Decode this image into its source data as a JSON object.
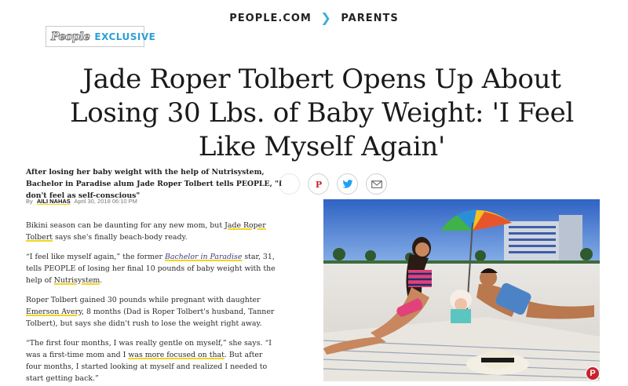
{
  "nav": {
    "site": "PEOPLE.COM",
    "separator": ">",
    "section": "PARENTS"
  },
  "badge": {
    "logo": "People",
    "label": "EXCLUSIVE"
  },
  "article": {
    "headline": "Jade Roper Tolbert Opens Up About Losing 30 Lbs. of Baby Weight: 'I Feel Like Myself Again'",
    "dek": "After losing her baby weight with the help of Nutrisystem, Bachelor in Paradise alum Jade Roper Tolbert tells PEOPLE, \"I don't feel as self-conscious\"",
    "byline": {
      "by": "By",
      "author": "AILI NAHAS",
      "date": "April 30, 2018 06:10 PM"
    },
    "paragraphs": {
      "p1": {
        "pre": "Bikini season can be daunting for any new mom, but ",
        "link": "Jade Roper Tolbert",
        "post": " says she's finally beach-body ready."
      },
      "p2": {
        "pre": "“I feel like myself again,” the former ",
        "link": "Bachelor in Paradise",
        "mid": " star, 31, tells PEOPLE of losing her final 10 pounds of baby weight with the help of ",
        "link2": "Nutrisystem",
        "post": "."
      },
      "p3": {
        "pre": "Roper Tolbert gained 30 pounds while pregnant with daughter ",
        "link": "Emerson Avery",
        "post": ", 8 months (Dad is Roper Tolbert's husband, Tanner Tolbert), but says she didn't rush to lose the weight right away."
      },
      "p4": {
        "pre": "“The first four months, I was really gentle on myself,” she says. “I was a first-time mom and I ",
        "link": "was more focused on that",
        "post": ". But after four months, I started looking at myself and realized I needed to start getting back.”"
      }
    }
  },
  "share": {
    "pinterest": "P",
    "twitter": "t",
    "email": "✉"
  },
  "photo_pin": "P",
  "colors": {
    "accent_blue": "#2e9fd6",
    "link_underline": "#f2d61e",
    "pinterest_red": "#c8232c"
  }
}
